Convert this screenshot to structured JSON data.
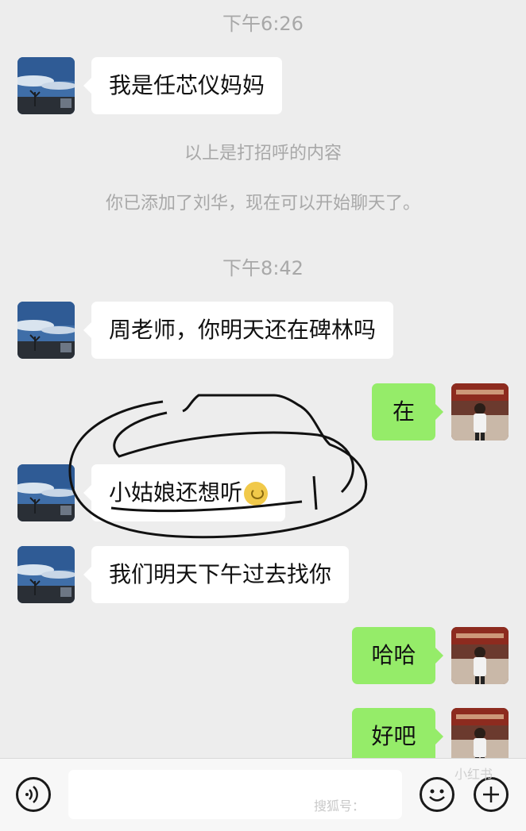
{
  "times": [
    "下午6:26",
    "下午8:42"
  ],
  "system_messages": [
    "以上是打招呼的内容",
    "你已添加了刘华，现在可以开始聊天了。"
  ],
  "messages": [
    {
      "side": "in",
      "text": "我是任芯仪妈妈"
    },
    {
      "side": "in",
      "text": "周老师，你明天还在碑林吗"
    },
    {
      "side": "out",
      "text": "在"
    },
    {
      "side": "in",
      "text": "小姑娘还想听",
      "emoji": "facepalm-emoji"
    },
    {
      "side": "in",
      "text": "我们明天下午过去找你"
    },
    {
      "side": "out",
      "text": "哈哈"
    },
    {
      "side": "out",
      "text": "好吧"
    }
  ],
  "bottom_bar": {
    "voice_icon": "voice-icon",
    "emoji_icon": "emoji-icon",
    "add_icon": "plus-icon",
    "watermark_text": "搜狐号：",
    "watermark_brand": "小红书"
  },
  "colors": {
    "background": "#ededed",
    "incoming_bubble": "#ffffff",
    "outgoing_bubble": "#95ec69",
    "annotation_ink": "#111111"
  }
}
